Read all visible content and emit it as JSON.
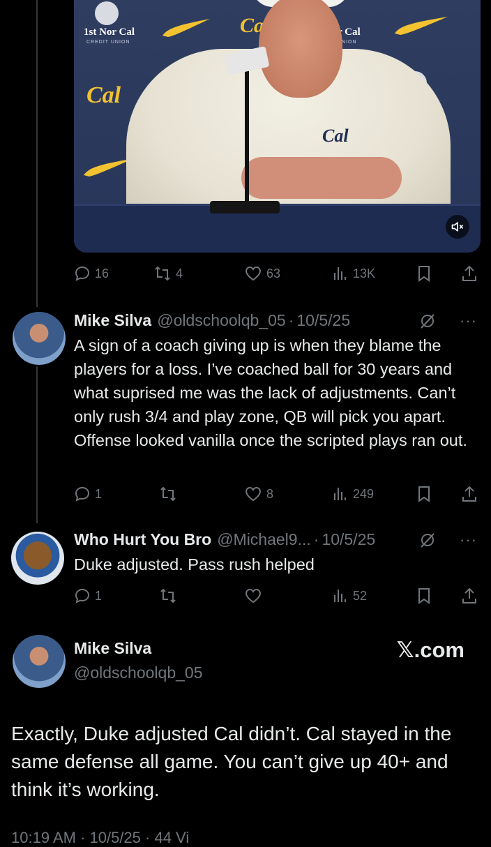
{
  "media": {
    "sponsor_name": "1st Nor Cal",
    "sponsor_sub": "CREDIT UNION",
    "sponsor_name_partial": "r Cal",
    "sponsor_sub_partial": "UNION",
    "cal_logo": "Cal",
    "mute_icon": "speaker-muted-icon"
  },
  "main_actions": {
    "replies": "16",
    "reposts": "4",
    "likes": "63",
    "views": "13K"
  },
  "reply1": {
    "name": "Mike Silva",
    "handle": "@oldschoolqb_05",
    "date": "10/5/25",
    "text": "A sign of a coach giving up is when they blame the players for a loss. I’ve coached ball for 30 years and what suprised me was the lack of adjustments. Can’t only rush 3/4 and play zone, QB will pick you apart. Offense looked vanilla once the scripted plays ran out.",
    "replies": "1",
    "reposts": "",
    "likes": "8",
    "views": "249"
  },
  "reply2": {
    "name": "Who Hurt You Bro",
    "handle": "@Michael9...",
    "date": "10/5/25",
    "text": "Duke adjusted. Pass rush helped",
    "replies": "1",
    "reposts": "",
    "likes": "",
    "views": "52"
  },
  "embed": {
    "name": "Mike Silva",
    "handle": "@oldschoolqb_05",
    "brand": "𝕏.com",
    "text": "Exactly, Duke adjusted Cal didn’t. Cal stayed in the same defense all game. You can’t give up 40+ and think it’s working.",
    "meta": "10:19 AM · 10/5/25 · 44 Vi"
  },
  "colors": {
    "background": "#000000",
    "text": "#e7e9ea",
    "muted": "#71767b",
    "cal_gold": "#f2c230",
    "backdrop_navy": "#2c3a5c"
  }
}
